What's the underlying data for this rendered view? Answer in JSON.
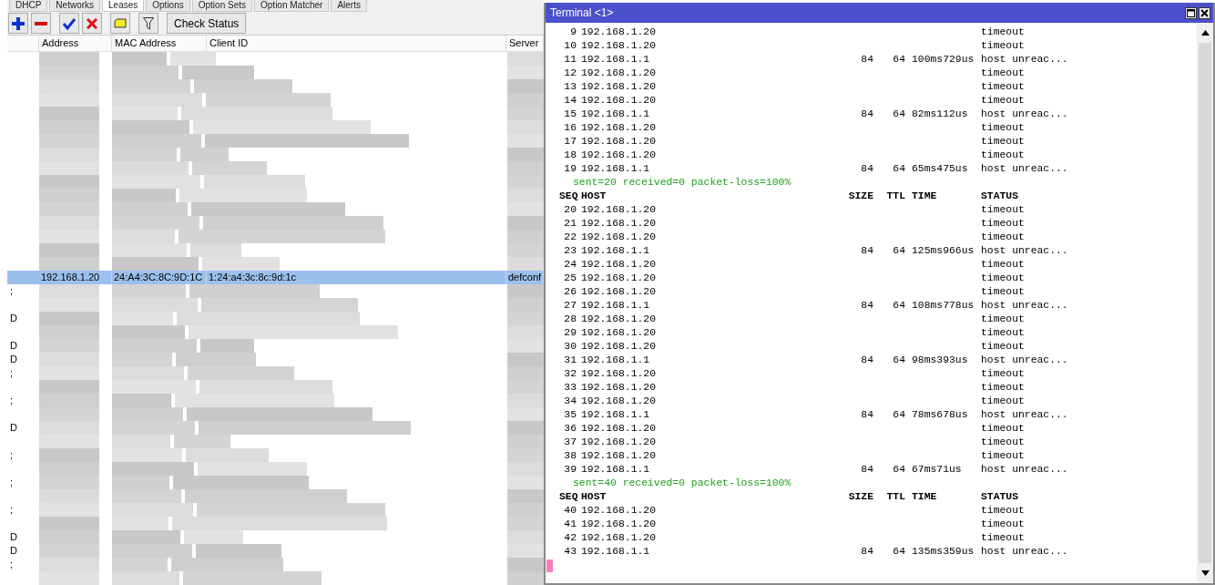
{
  "tabs": [
    {
      "label": "DHCP",
      "selected": false
    },
    {
      "label": "Networks",
      "selected": false
    },
    {
      "label": "Leases",
      "selected": true
    },
    {
      "label": "Options",
      "selected": false
    },
    {
      "label": "Option Sets",
      "selected": false
    },
    {
      "label": "Option Matcher",
      "selected": false
    },
    {
      "label": "Alerts",
      "selected": false
    }
  ],
  "toolbar": {
    "check_status": "Check Status"
  },
  "table": {
    "columns": [
      "Address",
      "MAC Address",
      "Client ID",
      "Server"
    ],
    "rows": [
      {
        "kind": "blurred",
        "flag": ""
      },
      {
        "kind": "blurred",
        "flag": ""
      },
      {
        "kind": "blurred",
        "flag": ""
      },
      {
        "kind": "blurred",
        "flag": ""
      },
      {
        "kind": "blurred",
        "flag": ""
      },
      {
        "kind": "blurred",
        "flag": ""
      },
      {
        "kind": "blurred",
        "flag": ""
      },
      {
        "kind": "blurred",
        "flag": ""
      },
      {
        "kind": "blurred",
        "flag": ""
      },
      {
        "kind": "blurred",
        "flag": ""
      },
      {
        "kind": "blurred",
        "flag": ""
      },
      {
        "kind": "blurred",
        "flag": ""
      },
      {
        "kind": "blurred",
        "flag": ""
      },
      {
        "kind": "blurred",
        "flag": ""
      },
      {
        "kind": "blurred",
        "flag": ""
      },
      {
        "kind": "blurred",
        "flag": ""
      },
      {
        "kind": "lease",
        "selected": true,
        "address": "192.168.1.20",
        "mac": "24:A4:3C:8C:9D:1C",
        "client_id": "1:24:a4:3c:8c:9d:1c",
        "server": "defconf"
      },
      {
        "kind": "blurred",
        "flag": ";"
      },
      {
        "kind": "blurred",
        "flag": ""
      },
      {
        "kind": "blurred",
        "flag": "D"
      },
      {
        "kind": "blurred",
        "flag": ""
      },
      {
        "kind": "blurred",
        "flag": "D"
      },
      {
        "kind": "blurred",
        "flag": "D"
      },
      {
        "kind": "blurred",
        "flag": ";"
      },
      {
        "kind": "blurred",
        "flag": ""
      },
      {
        "kind": "blurred",
        "flag": ";"
      },
      {
        "kind": "blurred",
        "flag": ""
      },
      {
        "kind": "blurred",
        "flag": "D"
      },
      {
        "kind": "blurred",
        "flag": ""
      },
      {
        "kind": "blurred",
        "flag": ";"
      },
      {
        "kind": "blurred",
        "flag": ""
      },
      {
        "kind": "blurred",
        "flag": ";"
      },
      {
        "kind": "blurred",
        "flag": ""
      },
      {
        "kind": "blurred",
        "flag": ";"
      },
      {
        "kind": "blurred",
        "flag": ""
      },
      {
        "kind": "blurred",
        "flag": "D"
      },
      {
        "kind": "blurred",
        "flag": "D"
      },
      {
        "kind": "blurred",
        "flag": ";"
      },
      {
        "kind": "blurred",
        "flag": ""
      }
    ]
  },
  "terminal": {
    "title": "Terminal <1>",
    "lines": [
      {
        "kind": "reply",
        "seq": "9",
        "host": "192.168.1.20",
        "status": "timeout"
      },
      {
        "kind": "reply",
        "seq": "10",
        "host": "192.168.1.20",
        "status": "timeout"
      },
      {
        "kind": "reply",
        "seq": "11",
        "host": "192.168.1.1",
        "size": "84",
        "ttl": "64",
        "time": "100ms729us",
        "status": "host unreac..."
      },
      {
        "kind": "reply",
        "seq": "12",
        "host": "192.168.1.20",
        "status": "timeout"
      },
      {
        "kind": "reply",
        "seq": "13",
        "host": "192.168.1.20",
        "status": "timeout"
      },
      {
        "kind": "reply",
        "seq": "14",
        "host": "192.168.1.20",
        "status": "timeout"
      },
      {
        "kind": "reply",
        "seq": "15",
        "host": "192.168.1.1",
        "size": "84",
        "ttl": "64",
        "time": "82ms112us",
        "status": "host unreac..."
      },
      {
        "kind": "reply",
        "seq": "16",
        "host": "192.168.1.20",
        "status": "timeout"
      },
      {
        "kind": "reply",
        "seq": "17",
        "host": "192.168.1.20",
        "status": "timeout"
      },
      {
        "kind": "reply",
        "seq": "18",
        "host": "192.168.1.20",
        "status": "timeout"
      },
      {
        "kind": "reply",
        "seq": "19",
        "host": "192.168.1.1",
        "size": "84",
        "ttl": "64",
        "time": "65ms475us",
        "status": "host unreac..."
      },
      {
        "kind": "summary",
        "text": "sent=20 received=0 packet-loss=100%"
      },
      {
        "kind": "header",
        "seq": "SEQ",
        "host": "HOST",
        "size": "SIZE",
        "ttl": "TTL",
        "time": "TIME",
        "status": "STATUS"
      },
      {
        "kind": "reply",
        "seq": "20",
        "host": "192.168.1.20",
        "status": "timeout"
      },
      {
        "kind": "reply",
        "seq": "21",
        "host": "192.168.1.20",
        "status": "timeout"
      },
      {
        "kind": "reply",
        "seq": "22",
        "host": "192.168.1.20",
        "status": "timeout"
      },
      {
        "kind": "reply",
        "seq": "23",
        "host": "192.168.1.1",
        "size": "84",
        "ttl": "64",
        "time": "125ms966us",
        "status": "host unreac..."
      },
      {
        "kind": "reply",
        "seq": "24",
        "host": "192.168.1.20",
        "status": "timeout"
      },
      {
        "kind": "reply",
        "seq": "25",
        "host": "192.168.1.20",
        "status": "timeout"
      },
      {
        "kind": "reply",
        "seq": "26",
        "host": "192.168.1.20",
        "status": "timeout"
      },
      {
        "kind": "reply",
        "seq": "27",
        "host": "192.168.1.1",
        "size": "84",
        "ttl": "64",
        "time": "108ms778us",
        "status": "host unreac..."
      },
      {
        "kind": "reply",
        "seq": "28",
        "host": "192.168.1.20",
        "status": "timeout"
      },
      {
        "kind": "reply",
        "seq": "29",
        "host": "192.168.1.20",
        "status": "timeout"
      },
      {
        "kind": "reply",
        "seq": "30",
        "host": "192.168.1.20",
        "status": "timeout"
      },
      {
        "kind": "reply",
        "seq": "31",
        "host": "192.168.1.1",
        "size": "84",
        "ttl": "64",
        "time": "98ms393us",
        "status": "host unreac..."
      },
      {
        "kind": "reply",
        "seq": "32",
        "host": "192.168.1.20",
        "status": "timeout"
      },
      {
        "kind": "reply",
        "seq": "33",
        "host": "192.168.1.20",
        "status": "timeout"
      },
      {
        "kind": "reply",
        "seq": "34",
        "host": "192.168.1.20",
        "status": "timeout"
      },
      {
        "kind": "reply",
        "seq": "35",
        "host": "192.168.1.1",
        "size": "84",
        "ttl": "64",
        "time": "78ms678us",
        "status": "host unreac..."
      },
      {
        "kind": "reply",
        "seq": "36",
        "host": "192.168.1.20",
        "status": "timeout"
      },
      {
        "kind": "reply",
        "seq": "37",
        "host": "192.168.1.20",
        "status": "timeout"
      },
      {
        "kind": "reply",
        "seq": "38",
        "host": "192.168.1.20",
        "status": "timeout"
      },
      {
        "kind": "reply",
        "seq": "39",
        "host": "192.168.1.1",
        "size": "84",
        "ttl": "64",
        "time": "67ms71us",
        "status": "host unreac..."
      },
      {
        "kind": "summary",
        "text": "sent=40 received=0 packet-loss=100%"
      },
      {
        "kind": "header",
        "seq": "SEQ",
        "host": "HOST",
        "size": "SIZE",
        "ttl": "TTL",
        "time": "TIME",
        "status": "STATUS"
      },
      {
        "kind": "reply",
        "seq": "40",
        "host": "192.168.1.20",
        "status": "timeout"
      },
      {
        "kind": "reply",
        "seq": "41",
        "host": "192.168.1.20",
        "status": "timeout"
      },
      {
        "kind": "reply",
        "seq": "42",
        "host": "192.168.1.20",
        "status": "timeout"
      },
      {
        "kind": "reply",
        "seq": "43",
        "host": "192.168.1.1",
        "size": "84",
        "ttl": "64",
        "time": "135ms359us",
        "status": "host unreac..."
      }
    ]
  }
}
